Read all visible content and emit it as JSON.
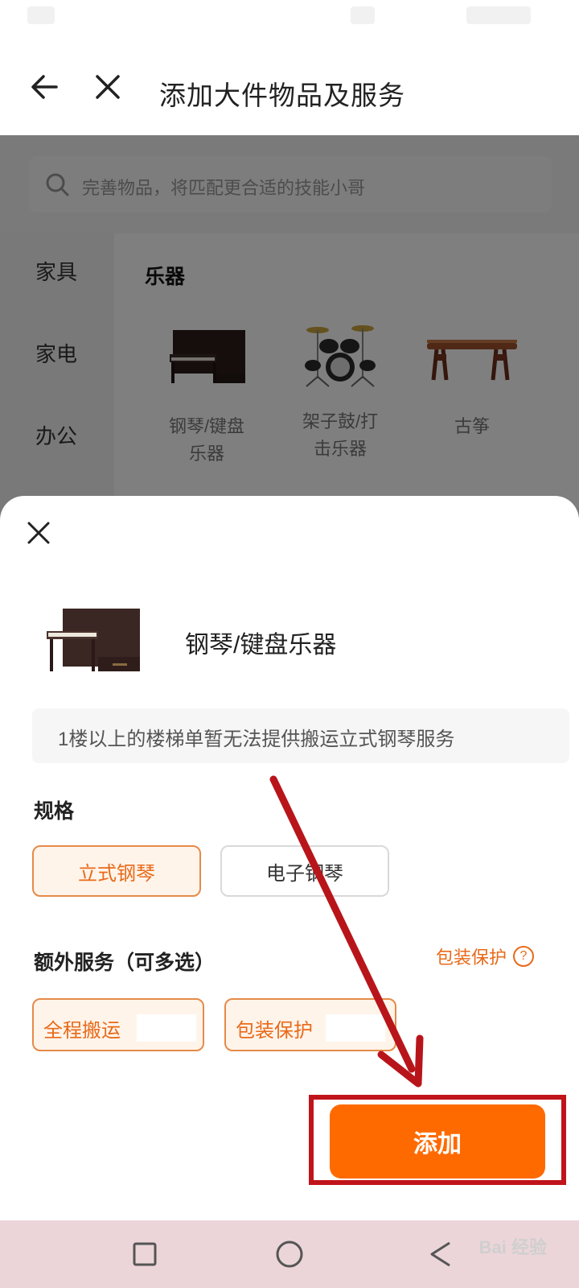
{
  "header": {
    "title": "添加大件物品及服务"
  },
  "search": {
    "placeholder": "完善物品，将匹配更合适的技能小哥"
  },
  "sidebar": {
    "items": [
      {
        "label": "家具"
      },
      {
        "label": "家电"
      },
      {
        "label": "办公"
      }
    ]
  },
  "category": {
    "title": "乐器",
    "items": [
      {
        "label_line1": "钢琴/键盘",
        "label_line2": "乐器",
        "icon": "piano-icon"
      },
      {
        "label_line1": "架子鼓/打",
        "label_line2": "击乐器",
        "icon": "drum-kit-icon"
      },
      {
        "label_line1": "古筝",
        "label_line2": "",
        "icon": "guzheng-icon"
      }
    ]
  },
  "sheet": {
    "product_name": "钢琴/键盘乐器",
    "notice": "1楼以上的楼梯单暂无法提供搬运立式钢琴服务",
    "spec_title": "规格",
    "specs": [
      {
        "label": "立式钢琴",
        "selected": true
      },
      {
        "label": "电子钢琴",
        "selected": false
      }
    ],
    "extra_title": "额外服务（可多选）",
    "extra_link": "包装保护",
    "extras": [
      {
        "label": "全程搬运"
      },
      {
        "label": "包装保护"
      }
    ],
    "add_label": "添加"
  },
  "watermark": {
    "text": "Bai 经验"
  },
  "colors": {
    "accent": "#ff6a00",
    "accent_text": "#e86a1a",
    "highlight_box": "#c0141b",
    "nav_bar": "#ecd5d9"
  }
}
